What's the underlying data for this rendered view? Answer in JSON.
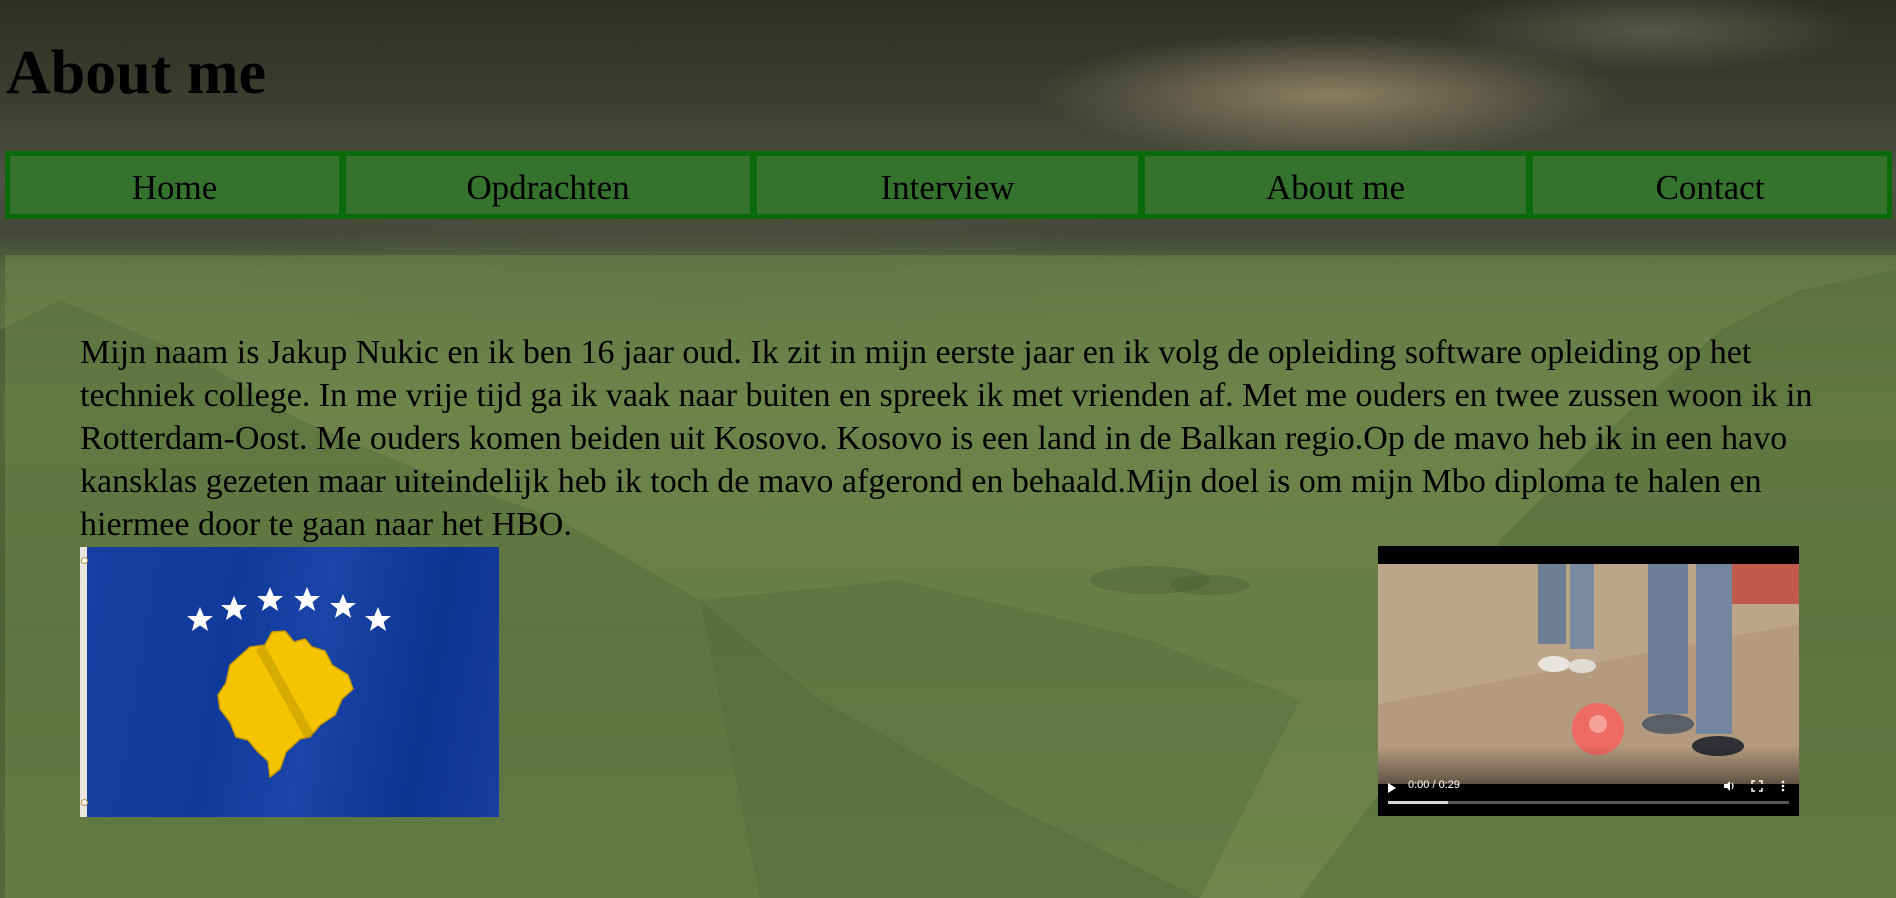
{
  "page": {
    "title": "About me"
  },
  "nav": {
    "items": [
      {
        "label": "Home"
      },
      {
        "label": "Opdrachten"
      },
      {
        "label": "Interview"
      },
      {
        "label": "About me"
      },
      {
        "label": "Contact"
      }
    ],
    "border_color": "#096a09",
    "background_color": "#34722e"
  },
  "about": {
    "text": "Mijn naam is Jakup Nukic en ik ben 16 jaar oud. Ik zit in mijn eerste jaar en ik volg de opleiding software opleiding op het techniek college. In me vrije tijd ga ik vaak naar buiten en spreek ik met vrienden af. Met me ouders en twee zussen woon ik in Rotterdam-Oost. Me ouders komen beiden uit Kosovo. Kosovo is een land in de Balkan regio.Op de mavo heb ik in een havo kansklas gezeten maar uiteindelijk heb ik toch de mavo afgerond en behaald.Mijn doel is om mijn Mbo diploma te halen en hiermee door te gaan naar het HBO."
  },
  "flag_image": {
    "icon": "kosovo-flag-icon",
    "colors": {
      "field": "#1b44a8",
      "map": "#f5c400",
      "stars": "#ffffff"
    }
  },
  "video": {
    "time": "0:00 / 0:29",
    "progress": 0.15,
    "icons": [
      "play-icon",
      "volume-icon",
      "fullscreen-icon",
      "more-options-icon"
    ]
  }
}
